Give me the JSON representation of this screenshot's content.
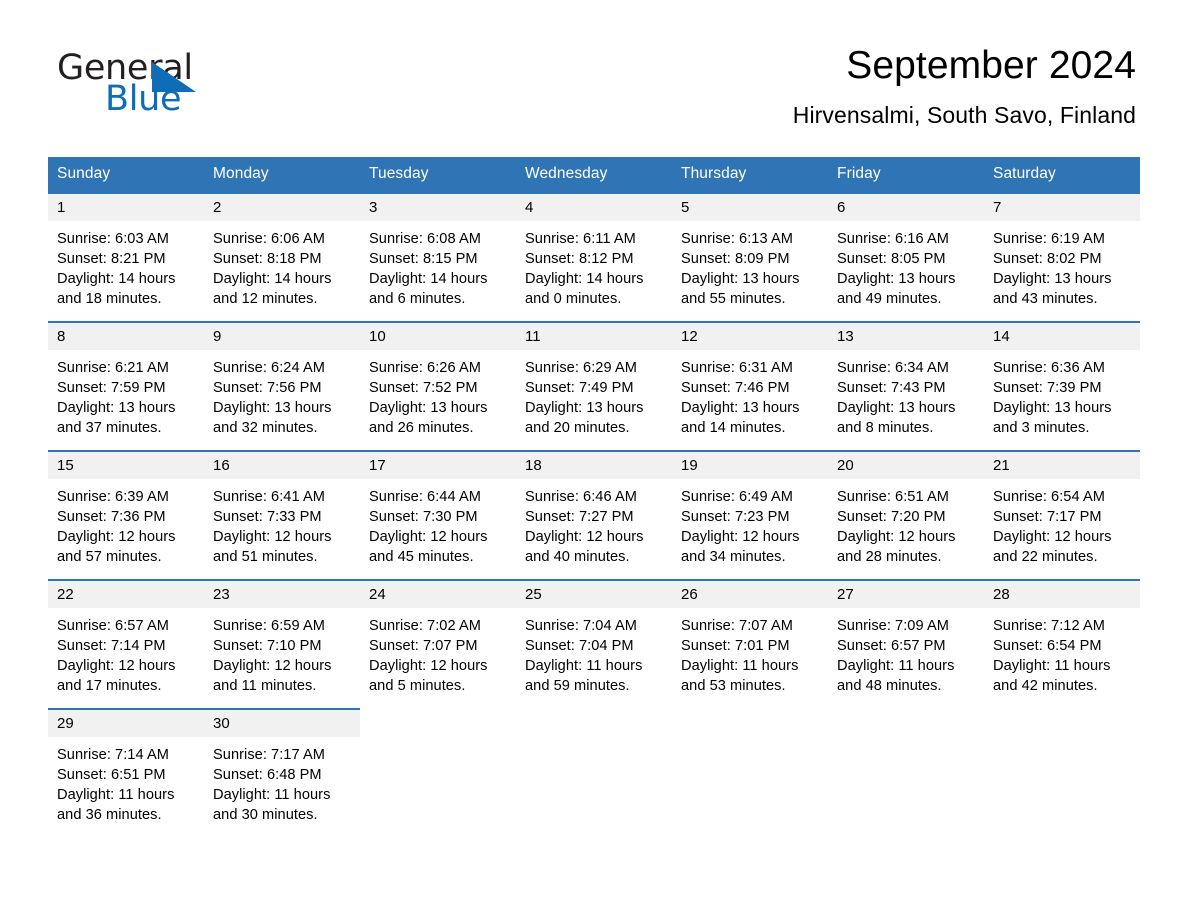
{
  "brand": {
    "name_part1": "General",
    "name_part2": "Blue",
    "accent_color": "#0f6cb6",
    "triangle_icon": "blue-triangle-logo-mark"
  },
  "header": {
    "title": "September 2024",
    "subtitle": "Hirvensalmi, South Savo, Finland"
  },
  "calendar": {
    "header_bg": "#2f74b5",
    "daynum_bg": "#f1f1f1",
    "weekday_headers": [
      "Sunday",
      "Monday",
      "Tuesday",
      "Wednesday",
      "Thursday",
      "Friday",
      "Saturday"
    ],
    "weeks": [
      [
        {
          "day": "1",
          "sunrise": "Sunrise: 6:03 AM",
          "sunset": "Sunset: 8:21 PM",
          "daylight_line1": "Daylight: 14 hours",
          "daylight_line2": "and 18 minutes."
        },
        {
          "day": "2",
          "sunrise": "Sunrise: 6:06 AM",
          "sunset": "Sunset: 8:18 PM",
          "daylight_line1": "Daylight: 14 hours",
          "daylight_line2": "and 12 minutes."
        },
        {
          "day": "3",
          "sunrise": "Sunrise: 6:08 AM",
          "sunset": "Sunset: 8:15 PM",
          "daylight_line1": "Daylight: 14 hours",
          "daylight_line2": "and 6 minutes."
        },
        {
          "day": "4",
          "sunrise": "Sunrise: 6:11 AM",
          "sunset": "Sunset: 8:12 PM",
          "daylight_line1": "Daylight: 14 hours",
          "daylight_line2": "and 0 minutes."
        },
        {
          "day": "5",
          "sunrise": "Sunrise: 6:13 AM",
          "sunset": "Sunset: 8:09 PM",
          "daylight_line1": "Daylight: 13 hours",
          "daylight_line2": "and 55 minutes."
        },
        {
          "day": "6",
          "sunrise": "Sunrise: 6:16 AM",
          "sunset": "Sunset: 8:05 PM",
          "daylight_line1": "Daylight: 13 hours",
          "daylight_line2": "and 49 minutes."
        },
        {
          "day": "7",
          "sunrise": "Sunrise: 6:19 AM",
          "sunset": "Sunset: 8:02 PM",
          "daylight_line1": "Daylight: 13 hours",
          "daylight_line2": "and 43 minutes."
        }
      ],
      [
        {
          "day": "8",
          "sunrise": "Sunrise: 6:21 AM",
          "sunset": "Sunset: 7:59 PM",
          "daylight_line1": "Daylight: 13 hours",
          "daylight_line2": "and 37 minutes."
        },
        {
          "day": "9",
          "sunrise": "Sunrise: 6:24 AM",
          "sunset": "Sunset: 7:56 PM",
          "daylight_line1": "Daylight: 13 hours",
          "daylight_line2": "and 32 minutes."
        },
        {
          "day": "10",
          "sunrise": "Sunrise: 6:26 AM",
          "sunset": "Sunset: 7:52 PM",
          "daylight_line1": "Daylight: 13 hours",
          "daylight_line2": "and 26 minutes."
        },
        {
          "day": "11",
          "sunrise": "Sunrise: 6:29 AM",
          "sunset": "Sunset: 7:49 PM",
          "daylight_line1": "Daylight: 13 hours",
          "daylight_line2": "and 20 minutes."
        },
        {
          "day": "12",
          "sunrise": "Sunrise: 6:31 AM",
          "sunset": "Sunset: 7:46 PM",
          "daylight_line1": "Daylight: 13 hours",
          "daylight_line2": "and 14 minutes."
        },
        {
          "day": "13",
          "sunrise": "Sunrise: 6:34 AM",
          "sunset": "Sunset: 7:43 PM",
          "daylight_line1": "Daylight: 13 hours",
          "daylight_line2": "and 8 minutes."
        },
        {
          "day": "14",
          "sunrise": "Sunrise: 6:36 AM",
          "sunset": "Sunset: 7:39 PM",
          "daylight_line1": "Daylight: 13 hours",
          "daylight_line2": "and 3 minutes."
        }
      ],
      [
        {
          "day": "15",
          "sunrise": "Sunrise: 6:39 AM",
          "sunset": "Sunset: 7:36 PM",
          "daylight_line1": "Daylight: 12 hours",
          "daylight_line2": "and 57 minutes."
        },
        {
          "day": "16",
          "sunrise": "Sunrise: 6:41 AM",
          "sunset": "Sunset: 7:33 PM",
          "daylight_line1": "Daylight: 12 hours",
          "daylight_line2": "and 51 minutes."
        },
        {
          "day": "17",
          "sunrise": "Sunrise: 6:44 AM",
          "sunset": "Sunset: 7:30 PM",
          "daylight_line1": "Daylight: 12 hours",
          "daylight_line2": "and 45 minutes."
        },
        {
          "day": "18",
          "sunrise": "Sunrise: 6:46 AM",
          "sunset": "Sunset: 7:27 PM",
          "daylight_line1": "Daylight: 12 hours",
          "daylight_line2": "and 40 minutes."
        },
        {
          "day": "19",
          "sunrise": "Sunrise: 6:49 AM",
          "sunset": "Sunset: 7:23 PM",
          "daylight_line1": "Daylight: 12 hours",
          "daylight_line2": "and 34 minutes."
        },
        {
          "day": "20",
          "sunrise": "Sunrise: 6:51 AM",
          "sunset": "Sunset: 7:20 PM",
          "daylight_line1": "Daylight: 12 hours",
          "daylight_line2": "and 28 minutes."
        },
        {
          "day": "21",
          "sunrise": "Sunrise: 6:54 AM",
          "sunset": "Sunset: 7:17 PM",
          "daylight_line1": "Daylight: 12 hours",
          "daylight_line2": "and 22 minutes."
        }
      ],
      [
        {
          "day": "22",
          "sunrise": "Sunrise: 6:57 AM",
          "sunset": "Sunset: 7:14 PM",
          "daylight_line1": "Daylight: 12 hours",
          "daylight_line2": "and 17 minutes."
        },
        {
          "day": "23",
          "sunrise": "Sunrise: 6:59 AM",
          "sunset": "Sunset: 7:10 PM",
          "daylight_line1": "Daylight: 12 hours",
          "daylight_line2": "and 11 minutes."
        },
        {
          "day": "24",
          "sunrise": "Sunrise: 7:02 AM",
          "sunset": "Sunset: 7:07 PM",
          "daylight_line1": "Daylight: 12 hours",
          "daylight_line2": "and 5 minutes."
        },
        {
          "day": "25",
          "sunrise": "Sunrise: 7:04 AM",
          "sunset": "Sunset: 7:04 PM",
          "daylight_line1": "Daylight: 11 hours",
          "daylight_line2": "and 59 minutes."
        },
        {
          "day": "26",
          "sunrise": "Sunrise: 7:07 AM",
          "sunset": "Sunset: 7:01 PM",
          "daylight_line1": "Daylight: 11 hours",
          "daylight_line2": "and 53 minutes."
        },
        {
          "day": "27",
          "sunrise": "Sunrise: 7:09 AM",
          "sunset": "Sunset: 6:57 PM",
          "daylight_line1": "Daylight: 11 hours",
          "daylight_line2": "and 48 minutes."
        },
        {
          "day": "28",
          "sunrise": "Sunrise: 7:12 AM",
          "sunset": "Sunset: 6:54 PM",
          "daylight_line1": "Daylight: 11 hours",
          "daylight_line2": "and 42 minutes."
        }
      ],
      [
        {
          "day": "29",
          "sunrise": "Sunrise: 7:14 AM",
          "sunset": "Sunset: 6:51 PM",
          "daylight_line1": "Daylight: 11 hours",
          "daylight_line2": "and 36 minutes."
        },
        {
          "day": "30",
          "sunrise": "Sunrise: 7:17 AM",
          "sunset": "Sunset: 6:48 PM",
          "daylight_line1": "Daylight: 11 hours",
          "daylight_line2": "and 30 minutes."
        },
        {
          "day": "",
          "sunrise": "",
          "sunset": "",
          "daylight_line1": "",
          "daylight_line2": ""
        },
        {
          "day": "",
          "sunrise": "",
          "sunset": "",
          "daylight_line1": "",
          "daylight_line2": ""
        },
        {
          "day": "",
          "sunrise": "",
          "sunset": "",
          "daylight_line1": "",
          "daylight_line2": ""
        },
        {
          "day": "",
          "sunrise": "",
          "sunset": "",
          "daylight_line1": "",
          "daylight_line2": ""
        },
        {
          "day": "",
          "sunrise": "",
          "sunset": "",
          "daylight_line1": "",
          "daylight_line2": ""
        }
      ]
    ]
  }
}
